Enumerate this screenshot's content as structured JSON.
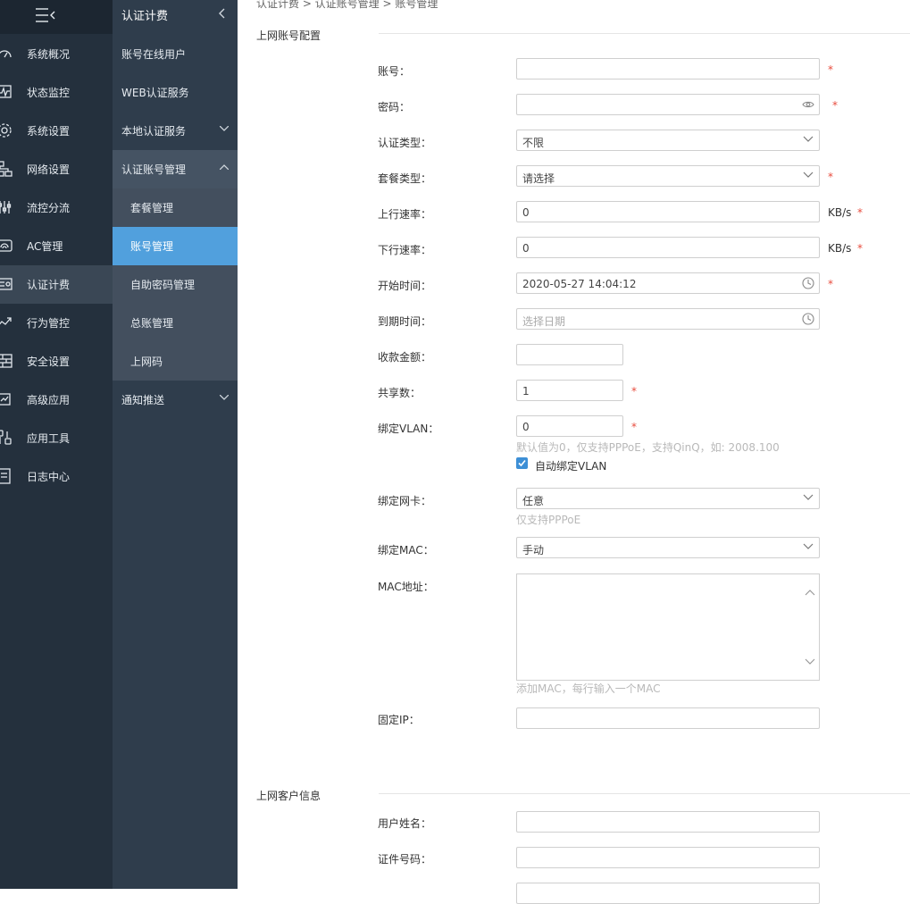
{
  "nav1": {
    "items": [
      {
        "label": "系统概况",
        "icon": "dashboard-icon"
      },
      {
        "label": "状态监控",
        "icon": "monitor-icon"
      },
      {
        "label": "系统设置",
        "icon": "gear-icon"
      },
      {
        "label": "网络设置",
        "icon": "network-icon"
      },
      {
        "label": "流控分流",
        "icon": "sliders-icon"
      },
      {
        "label": "AC管理",
        "icon": "wifi-icon"
      },
      {
        "label": "认证计费",
        "icon": "billing-icon"
      },
      {
        "label": "行为管控",
        "icon": "behavior-icon"
      },
      {
        "label": "安全设置",
        "icon": "firewall-icon"
      },
      {
        "label": "高级应用",
        "icon": "advanced-icon"
      },
      {
        "label": "应用工具",
        "icon": "tools-icon"
      },
      {
        "label": "日志中心",
        "icon": "log-icon"
      }
    ],
    "active_index": 6
  },
  "nav2": {
    "title": "认证计费",
    "items": [
      {
        "label": "账号在线用户",
        "kind": "top"
      },
      {
        "label": "WEB认证服务",
        "kind": "top"
      },
      {
        "label": "本地认证服务",
        "kind": "top",
        "chevron": "down"
      },
      {
        "label": "认证账号管理",
        "kind": "expanded",
        "chevron": "up"
      },
      {
        "label": "套餐管理",
        "kind": "sub"
      },
      {
        "label": "账号管理",
        "kind": "sub",
        "active": true
      },
      {
        "label": "自助密码管理",
        "kind": "sub"
      },
      {
        "label": "总账管理",
        "kind": "sub"
      },
      {
        "label": "上网码",
        "kind": "sub"
      },
      {
        "label": "通知推送",
        "kind": "top",
        "chevron": "down"
      }
    ]
  },
  "breadcrumb": "认证计费 > 认证账号管理 > 账号管理",
  "section1": {
    "title": "上网账号配置"
  },
  "section2": {
    "title": "上网客户信息"
  },
  "form": {
    "account": {
      "label": "账号：",
      "value": ""
    },
    "password": {
      "label": "密码：",
      "value": ""
    },
    "auth_type": {
      "label": "认证类型：",
      "value": "不限"
    },
    "package_type": {
      "label": "套餐类型：",
      "value": "请选择"
    },
    "up_rate": {
      "label": "上行速率：",
      "value": "0",
      "unit": "KB/s"
    },
    "down_rate": {
      "label": "下行速率：",
      "value": "0",
      "unit": "KB/s"
    },
    "start_time": {
      "label": "开始时间：",
      "value": "2020-05-27 14:04:12"
    },
    "expire_time": {
      "label": "到期时间：",
      "placeholder": "选择日期"
    },
    "amount": {
      "label": "收款金额：",
      "value": ""
    },
    "share_count": {
      "label": "共享数：",
      "value": "1"
    },
    "vlan": {
      "label": "绑定VLAN：",
      "value": "0",
      "hint": "默认值为0，仅支持PPPoE，支持QinQ，如: 2008.100",
      "auto_label": "自动绑定VLAN",
      "auto_checked": true
    },
    "nic": {
      "label": "绑定网卡：",
      "value": "任意",
      "hint": "仅支持PPPoE"
    },
    "mac_bind": {
      "label": "绑定MAC：",
      "value": "手动"
    },
    "mac_addr": {
      "label": "MAC地址：",
      "hint": "添加MAC，每行输入一个MAC"
    },
    "fixed_ip": {
      "label": "固定IP：",
      "value": ""
    },
    "user_name": {
      "label": "用户姓名：",
      "value": ""
    },
    "id_number": {
      "label": "证件号码：",
      "value": ""
    },
    "required_mark": "*"
  }
}
